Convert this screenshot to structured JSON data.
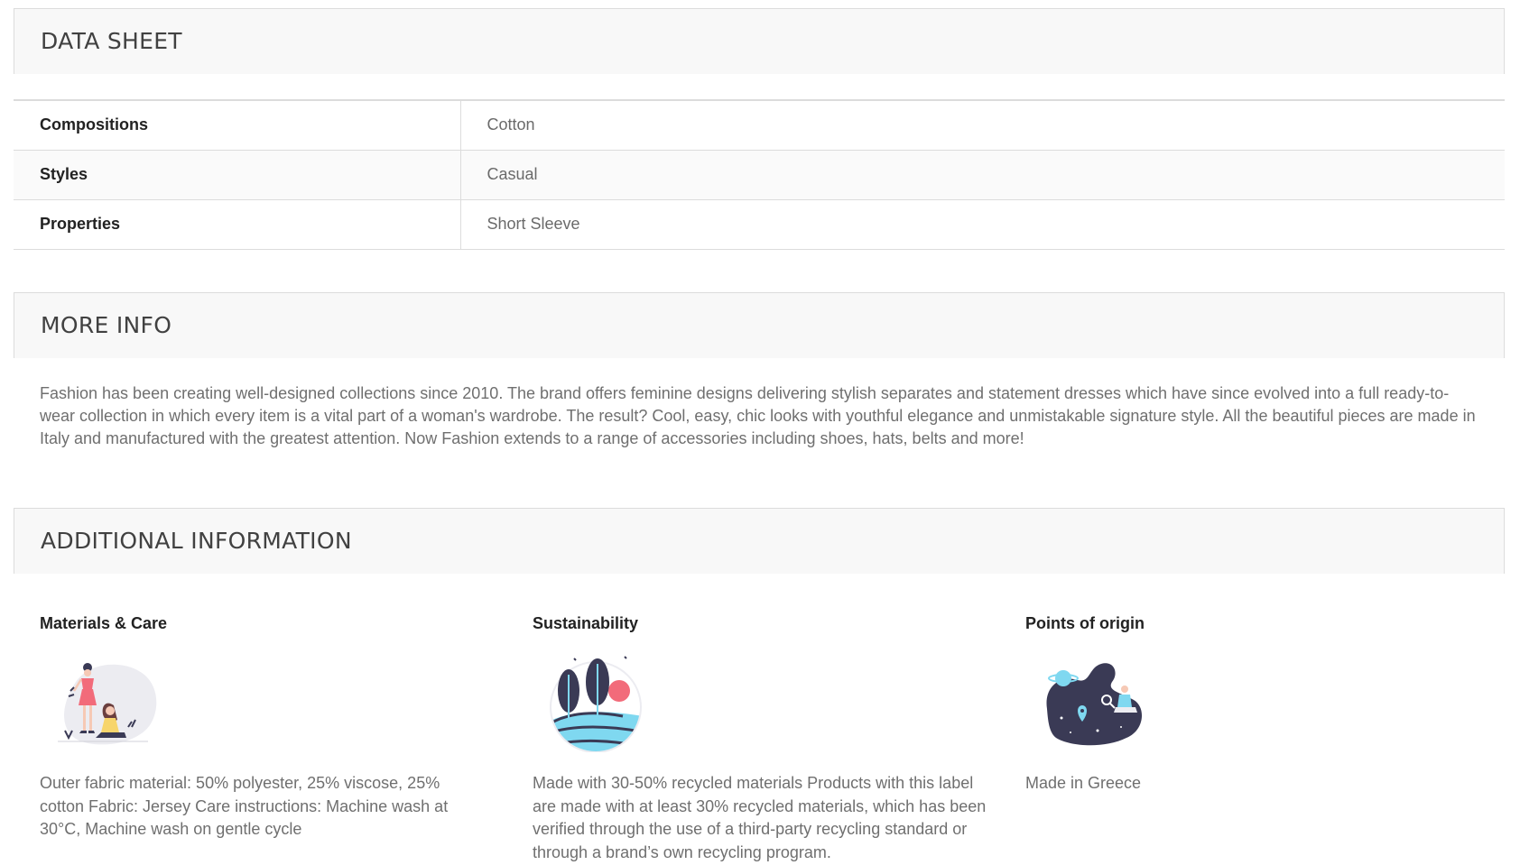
{
  "data_sheet": {
    "title": "DATA SHEET",
    "rows": [
      {
        "name": "Compositions",
        "value": "Cotton"
      },
      {
        "name": "Styles",
        "value": "Casual"
      },
      {
        "name": "Properties",
        "value": "Short Sleeve"
      }
    ]
  },
  "more_info": {
    "title": "MORE INFO",
    "text": "Fashion has been creating well-designed collections since 2010. The brand offers feminine designs delivering stylish separates and statement dresses which have since evolved into a full ready-to-wear collection in which every item is a vital part of a woman's wardrobe. The result? Cool, easy, chic looks with youthful elegance and unmistakable signature style. All the beautiful pieces are made in Italy and manufactured with the greatest attention. Now Fashion extends to a range of accessories including shoes, hats, belts and more!"
  },
  "additional_information": {
    "title": "ADDITIONAL INFORMATION",
    "columns": [
      {
        "title": "Materials & Care",
        "icon": "women-fashion-illustration",
        "text": "Outer fabric material: 50% polyester, 25% viscose, 25% cotton Fabric: Jersey Care instructions: Machine wash at 30°C, Machine wash on gentle cycle"
      },
      {
        "title": "Sustainability",
        "icon": "nature-landscape-illustration",
        "text": "Made with 30-50% recycled materials Products with this label are made with at least 30% recycled materials, which has been verified through the use of a third-party recycling standard or through a brand’s own recycling program."
      },
      {
        "title": "Points of origin",
        "icon": "space-map-illustration",
        "text": "Made in Greece"
      }
    ]
  },
  "colors": {
    "header_bg": "#f8f8f8",
    "border": "#dcdcdc",
    "heading_text": "#414141",
    "body_text": "#6f6f6f",
    "accent_pink": "#f26b7a",
    "accent_cyan": "#7fd8f0",
    "dark_navy": "#3a3a55"
  }
}
